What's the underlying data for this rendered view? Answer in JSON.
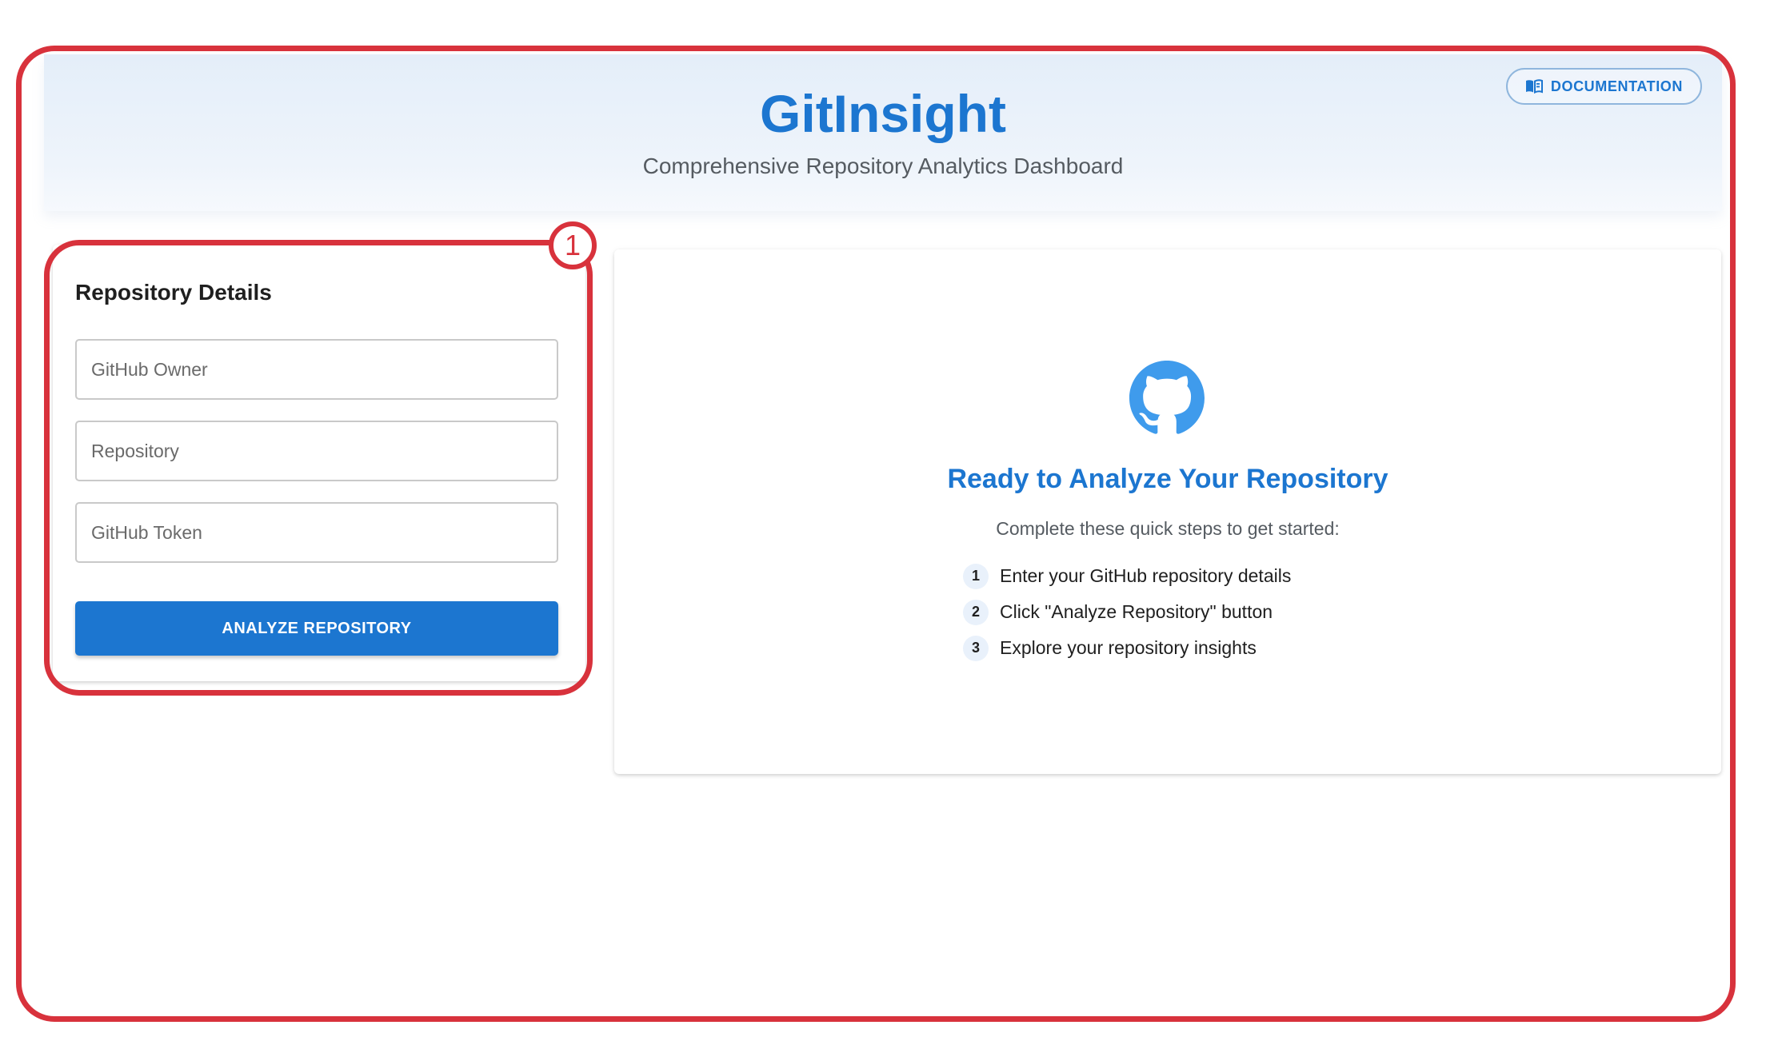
{
  "header": {
    "title": "GitInsight",
    "subtitle": "Comprehensive Repository Analytics Dashboard",
    "documentation_label": "DOCUMENTATION"
  },
  "repository_form": {
    "title": "Repository Details",
    "owner_placeholder": "GitHub Owner",
    "owner_value": "",
    "repo_placeholder": "Repository",
    "repo_value": "",
    "token_placeholder": "GitHub Token",
    "token_value": "",
    "analyze_label": "ANALYZE REPOSITORY"
  },
  "annotation": {
    "badge": "1",
    "color": "#d8323c"
  },
  "welcome": {
    "icon": "github-icon",
    "title": "Ready to Analyze Your Repository",
    "subtitle": "Complete these quick steps to get started:",
    "steps": [
      {
        "number": "1",
        "text": "Enter your GitHub repository details"
      },
      {
        "number": "2",
        "text": "Click \"Analyze Repository\" button"
      },
      {
        "number": "3",
        "text": "Explore your repository insights"
      }
    ]
  },
  "colors": {
    "primary": "#1c76d0",
    "annotation_red": "#d8323c"
  }
}
